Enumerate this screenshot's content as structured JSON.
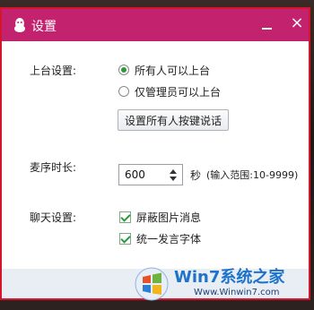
{
  "window": {
    "title": "设置",
    "icons": {
      "app": "penguin-icon",
      "minimize": "minimize-icon",
      "close": "close-icon"
    },
    "close_glyph": "×",
    "accent": "#c3226e",
    "frame_highlight": "#d4152c"
  },
  "stage": {
    "label": "上台设置:",
    "options": [
      {
        "label": "所有人可以上台",
        "selected": true
      },
      {
        "label": "仅管理员可以上台",
        "selected": false
      }
    ],
    "hotkey_button": "设置所有人按键说话"
  },
  "mic_order": {
    "label": "麦序时长:",
    "value": "600",
    "unit": "秒",
    "range_hint": "(输入范围:10-9999)"
  },
  "chat": {
    "label": "聊天设置:",
    "options": [
      {
        "label": "屏蔽图片消息",
        "checked": true
      },
      {
        "label": "统一发言字体",
        "checked": true
      }
    ]
  },
  "watermark": {
    "logo_icon": "windows-logo-icon",
    "brand": "Win7系统之家",
    "url": "Www.Winwin7.com"
  }
}
